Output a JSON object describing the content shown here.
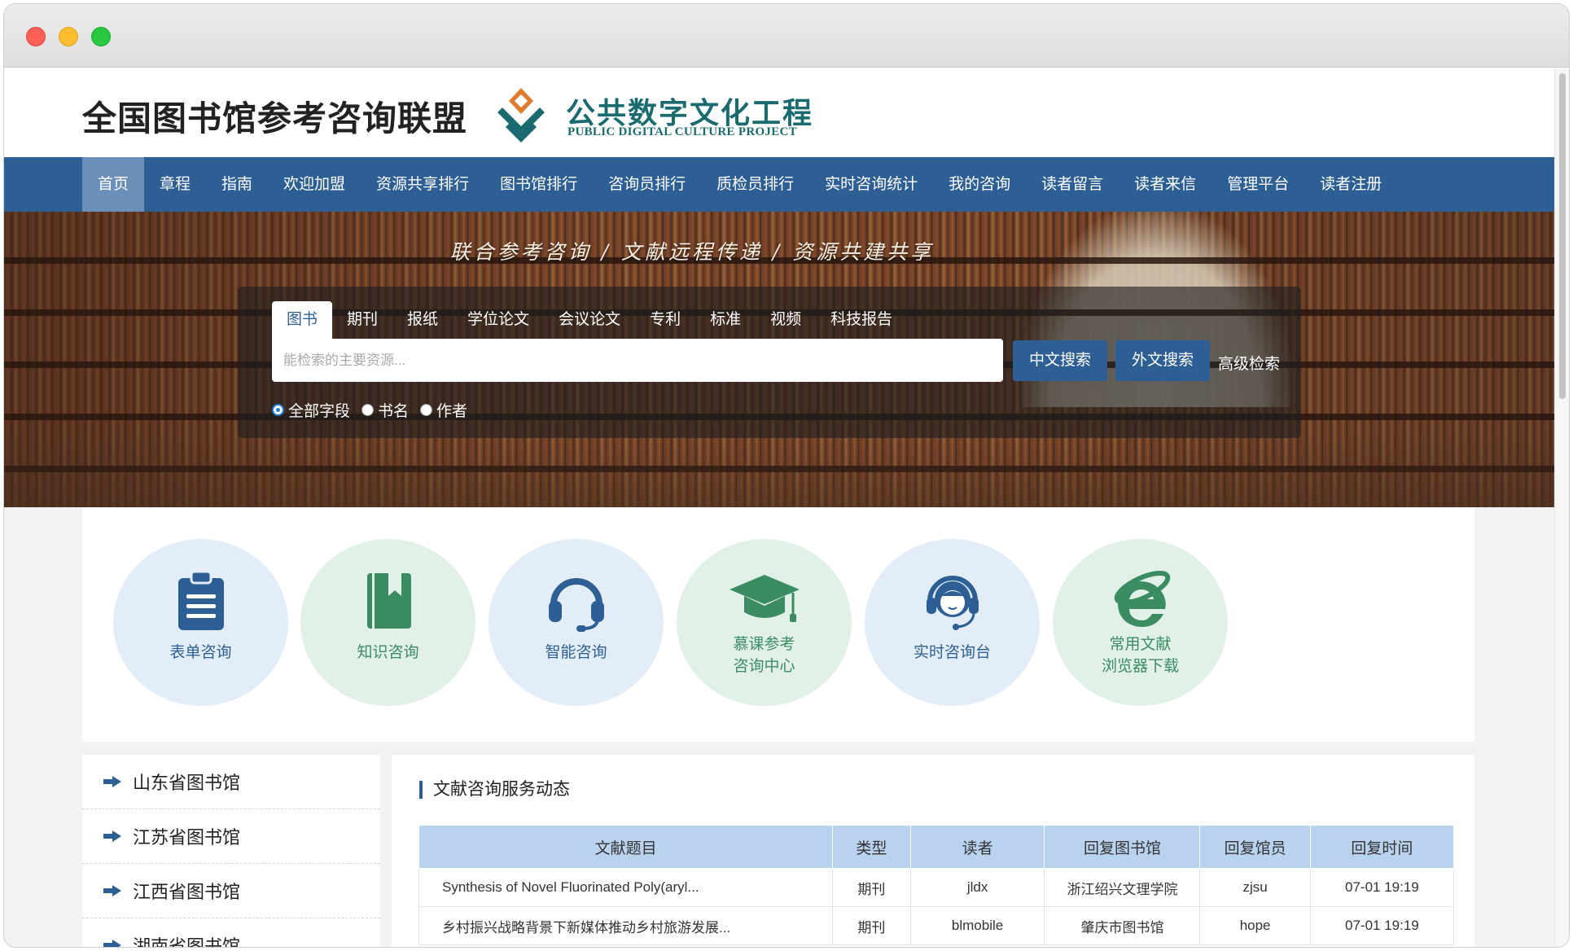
{
  "header": {
    "site_title": "全国图书馆参考咨询联盟",
    "logo_cn": "公共数字文化工程",
    "logo_en": "PUBLIC DIGITAL CULTURE PROJECT"
  },
  "nav": {
    "items": [
      "首页",
      "章程",
      "指南",
      "欢迎加盟",
      "资源共享排行",
      "图书馆排行",
      "咨询员排行",
      "质检员排行",
      "实时咨询统计",
      "我的咨询",
      "读者留言",
      "读者来信",
      "管理平台",
      "读者注册"
    ],
    "active_index": 0
  },
  "banner": {
    "slogan": "联合参考咨询 / 文献远程传递 / 资源共建共享"
  },
  "search": {
    "tabs": [
      "图书",
      "期刊",
      "报纸",
      "学位论文",
      "会议论文",
      "专利",
      "标准",
      "视频",
      "科技报告"
    ],
    "active_tab": 0,
    "placeholder": "能检索的主要资源...",
    "value": "",
    "btn_cn": "中文搜索",
    "btn_en": "外文搜索",
    "advanced": "高级检索",
    "fields": [
      "全部字段",
      "书名",
      "作者"
    ],
    "selected_field": 0
  },
  "services": [
    {
      "line1": "表单咨询",
      "line2": "",
      "icon": "clipboard-icon",
      "theme": "blue"
    },
    {
      "line1": "知识咨询",
      "line2": "",
      "icon": "book-icon",
      "theme": "green"
    },
    {
      "line1": "智能咨询",
      "line2": "",
      "icon": "headset-icon",
      "theme": "blue"
    },
    {
      "line1": "慕课参考",
      "line2": "咨询中心",
      "icon": "graduation-cap-icon",
      "theme": "green"
    },
    {
      "line1": "实时咨询台",
      "line2": "",
      "icon": "support-agent-icon",
      "theme": "blue"
    },
    {
      "line1": "常用文献",
      "line2": "浏览器下载",
      "icon": "ie-browser-icon",
      "theme": "green"
    }
  ],
  "libraries": [
    "山东省图书馆",
    "江苏省图书馆",
    "江西省图书馆",
    "湖南省图书馆"
  ],
  "dynamics": {
    "title": "文献咨询服务动态",
    "columns": [
      "文献题目",
      "类型",
      "读者",
      "回复图书馆",
      "回复馆员",
      "回复时间"
    ],
    "rows": [
      [
        "Synthesis of Novel Fluorinated Poly(aryl...",
        "期刊",
        "jldx",
        "浙江绍兴文理学院",
        "zjsu",
        "07-01 19:19"
      ],
      [
        "乡村振兴战略背景下新媒体推动乡村旅游发展...",
        "期刊",
        "blmobile",
        "肇庆市图书馆",
        "hope",
        "07-01 19:19"
      ]
    ]
  },
  "colors": {
    "nav_bg": "#2d5f95",
    "nav_active": "#6a8fb8",
    "service_blue": "#e3edf8",
    "service_green": "#e1f1e8",
    "table_header": "#b9d3ef",
    "logo_teal": "#1a6b6f"
  }
}
